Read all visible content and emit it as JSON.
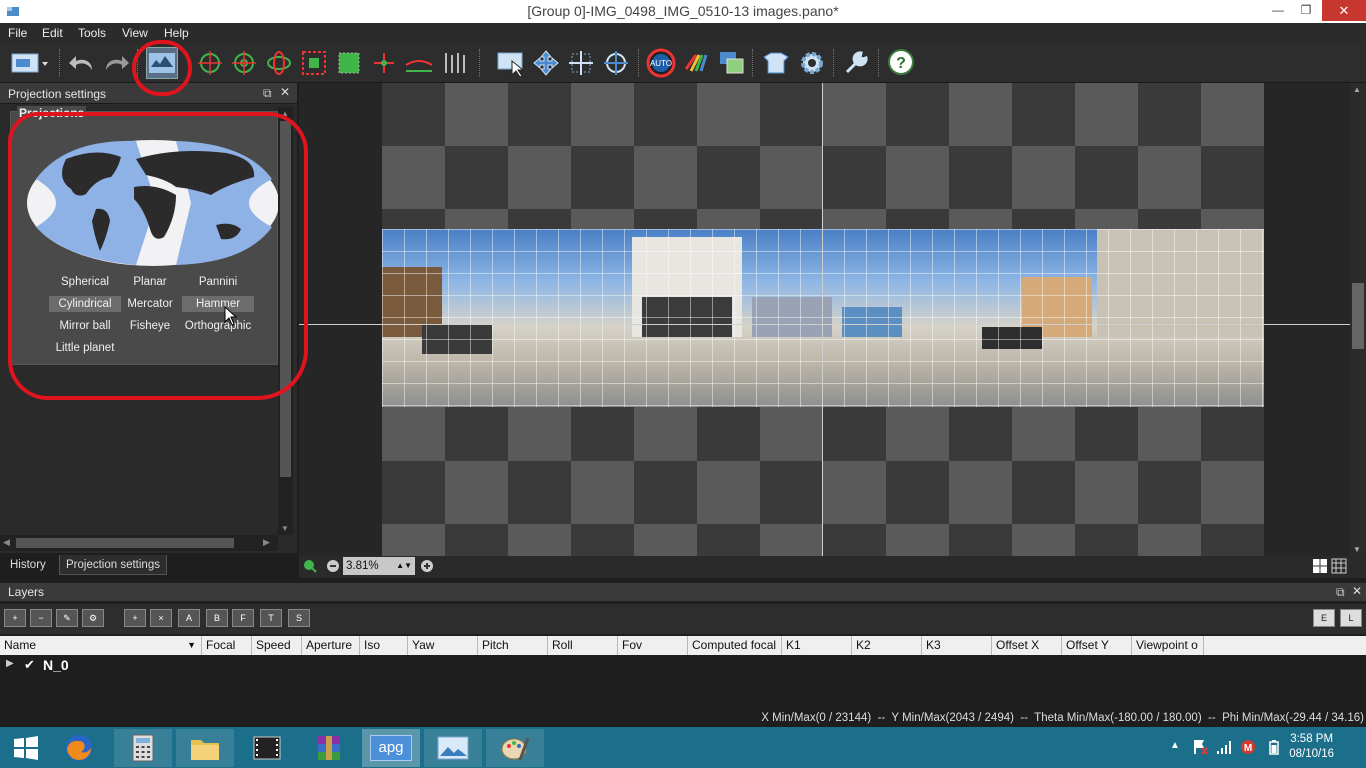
{
  "window": {
    "title": "[Group 0]-IMG_0498_IMG_0510-13 images.pano*",
    "min_glyph": "—",
    "max_glyph": "❐",
    "close_glyph": "✕"
  },
  "menu": [
    "File",
    "Edit",
    "Tools",
    "View",
    "Help"
  ],
  "toolbar": {
    "icons": [
      "screenshot-icon",
      "undo-icon",
      "redo-icon",
      "projection-icon",
      "target-icon",
      "target-crosshair-icon",
      "rotate-icon",
      "crop-red-icon",
      "crop-green-icon",
      "point-add-icon",
      "horizon-icon",
      "vertical-lines-icon",
      "select-icon",
      "move-icon",
      "stretch-icon",
      "center-icon",
      "auto-icon",
      "color-icon",
      "blend-icon",
      "export-icon",
      "settings-icon",
      "tools-icon",
      "help-icon"
    ]
  },
  "left_panel": {
    "title": "Projection settings",
    "projections_label": "Projections",
    "options": [
      {
        "label": "Spherical",
        "selected": false
      },
      {
        "label": "Planar",
        "selected": false
      },
      {
        "label": "Pannini",
        "selected": false
      },
      {
        "label": "Cylindrical",
        "selected": true
      },
      {
        "label": "Mercator",
        "selected": false
      },
      {
        "label": "Hammer",
        "selected": true
      },
      {
        "label": "Mirror ball",
        "selected": false
      },
      {
        "label": "Fisheye",
        "selected": false
      },
      {
        "label": "Orthographic",
        "selected": false
      },
      {
        "label": "Little planet",
        "selected": false
      }
    ],
    "tabs": [
      {
        "label": "History",
        "active": false
      },
      {
        "label": "Projection settings",
        "active": true
      }
    ]
  },
  "preview": {
    "zoom": "3.81%"
  },
  "layers": {
    "title": "Layers",
    "toolbar_letters": [
      "A",
      "B",
      "F",
      "T",
      "S"
    ],
    "right_letters": [
      "E",
      "L"
    ],
    "columns": [
      "Name",
      "Focal",
      "Speed",
      "Aperture",
      "Iso",
      "Yaw",
      "Pitch",
      "Roll",
      "Fov",
      "Computed focal",
      "K1",
      "K2",
      "K3",
      "Offset X",
      "Offset Y",
      "Viewpoint o"
    ],
    "rows": [
      {
        "name": "N_0",
        "checked": true
      }
    ]
  },
  "status": {
    "text": "X Min/Max(0 / 23144)  --  Y Min/Max(2043 / 2494)  --  Theta Min/Max(-180.00 / 180.00)  --  Phi Min/Max(-29.44 / 34.16)"
  },
  "taskbar": {
    "apps": [
      "windows-icon",
      "firefox-icon",
      "calculator-icon",
      "file-explorer-icon",
      "movie-icon",
      "winrar-icon",
      "apg-app",
      "photos-icon",
      "paint-icon"
    ],
    "apg_label": "apg",
    "time": "3:58 PM",
    "date": "08/10/16"
  },
  "colors": {
    "annotation": "#e0141e",
    "taskbar": "#1c6f8a",
    "accent": "#2b6fb5"
  }
}
